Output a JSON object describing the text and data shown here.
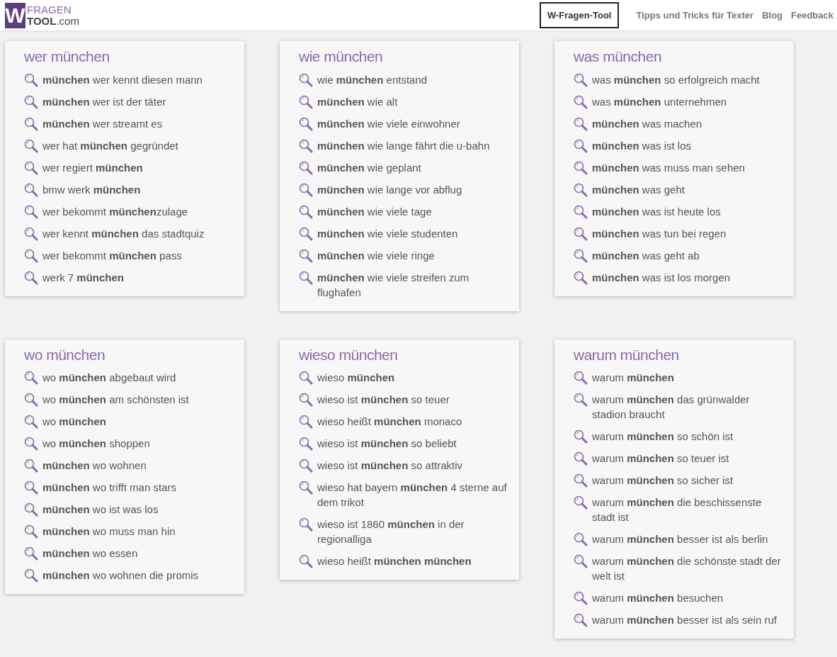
{
  "logo": {
    "letter": "W",
    "line1": "FRAGEN",
    "line2": "TOOL",
    "suffix": ".com"
  },
  "nav": [
    {
      "label": "W-Fragen-Tool",
      "selected": true
    },
    {
      "label": "Tipps und Tricks für Texter",
      "selected": false
    },
    {
      "label": "Blog",
      "selected": false
    },
    {
      "label": "Feedback",
      "selected": false
    }
  ],
  "cards": [
    {
      "title": "wer münchen",
      "items": [
        "**münchen** wer kennt diesen mann",
        "**münchen** wer ist der täter",
        "**münchen** wer streamt es",
        "wer hat **münchen** gegründet",
        "wer regiert **münchen**",
        "bmw werk **münchen**",
        "wer bekommt **münchen**zulage",
        "wer kennt **münchen** das stadtquiz",
        "wer bekommt **münchen** pass",
        "werk 7 **münchen**"
      ]
    },
    {
      "title": "wie münchen",
      "items": [
        "wie **münchen** entstand",
        "**münchen** wie alt",
        "**münchen** wie viele einwohner",
        "**münchen** wie lange fährt die u-bahn",
        "**münchen** wie geplant",
        "**münchen** wie lange vor abflug",
        "**münchen** wie viele tage",
        "**münchen** wie viele studenten",
        "**münchen** wie viele ringe",
        "**münchen** wie viele streifen zum flughafen"
      ]
    },
    {
      "title": "was münchen",
      "items": [
        "was **münchen** so erfolgreich macht",
        "was **münchen** unternehmen",
        "**münchen** was machen",
        "**münchen** was ist los",
        "**münchen** was muss man sehen",
        "**münchen** was geht",
        "**münchen** was ist heute los",
        "**münchen** was tun bei regen",
        "**münchen** was geht ab",
        "**münchen** was ist los morgen"
      ]
    },
    {
      "title": "wo münchen",
      "items": [
        "wo **münchen** abgebaut wird",
        "wo **münchen** am schönsten ist",
        "wo **münchen**",
        "wo **münchen** shoppen",
        "**münchen** wo wohnen",
        "**münchen** wo trifft man stars",
        "**münchen** wo ist was los",
        "**münchen** wo muss man hin",
        "**münchen** wo essen",
        "**münchen** wo wohnen die promis"
      ]
    },
    {
      "title": "wieso münchen",
      "items": [
        "wieso **münchen**",
        "wieso ist **münchen** so teuer",
        "wieso heißt **münchen** monaco",
        "wieso ist **münchen** so beliebt",
        "wieso ist **münchen** so attraktiv",
        "wieso hat bayern **münchen** 4 sterne auf dem trikot",
        "wieso ist 1860 **münchen** in der regionalliga",
        "wieso heißt **münchen münchen**"
      ]
    },
    {
      "title": "warum münchen",
      "items": [
        "warum **münchen**",
        "warum **münchen** das grünwalder stadion braucht",
        "warum **münchen** so schön ist",
        "warum **münchen** so teuer ist",
        "warum **münchen** so sicher ist",
        "warum **münchen** die beschissenste stadt ist",
        "warum **münchen** besser ist als berlin",
        "warum **münchen** die schönste stadt der welt ist",
        "warum **münchen** besuchen",
        "warum **münchen** besser ist als sein ruf"
      ]
    }
  ]
}
